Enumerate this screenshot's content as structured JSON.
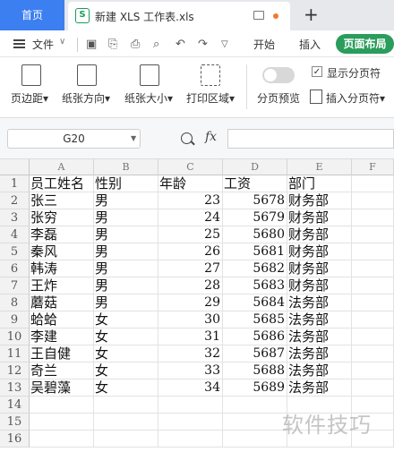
{
  "tabs": {
    "home": "首页",
    "file": "新建 XLS 工作表.xls",
    "file_icon": "S"
  },
  "menu": {
    "file": "文件",
    "start": "开始",
    "insert": "插入",
    "page_layout": "页面布局",
    "colors": {
      "active_tab_bg": "#2a9d5c",
      "home_tab_bg": "#3c7ff0"
    }
  },
  "ribbon": {
    "margins": "页边距",
    "orientation": "纸张方向",
    "paper_size": "纸张大小",
    "print_area": "打印区域",
    "page_break_preview": "分页预览",
    "show_page_breaks": "显示分页符",
    "show_page_breaks_checked": true,
    "insert_page_break": "插入分页符"
  },
  "formula_bar": {
    "name_box": "G20",
    "fx": "fx",
    "value": ""
  },
  "sheet": {
    "columns": [
      "A",
      "B",
      "C",
      "D",
      "E",
      "F"
    ],
    "row_numbers": [
      "1",
      "2",
      "3",
      "4",
      "5",
      "6",
      "7",
      "8",
      "9",
      "10",
      "11",
      "12",
      "13",
      "14",
      "15",
      "16"
    ],
    "header": [
      "员工姓名",
      "性别",
      "年龄",
      "工资",
      "部门"
    ],
    "rows": [
      [
        "张三",
        "男",
        "23",
        "5678",
        "财务部"
      ],
      [
        "张穷",
        "男",
        "24",
        "5679",
        "财务部"
      ],
      [
        "李磊",
        "男",
        "25",
        "5680",
        "财务部"
      ],
      [
        "秦风",
        "男",
        "26",
        "5681",
        "财务部"
      ],
      [
        "韩涛",
        "男",
        "27",
        "5682",
        "财务部"
      ],
      [
        "王炸",
        "男",
        "28",
        "5683",
        "财务部"
      ],
      [
        "蘑菇",
        "男",
        "29",
        "5684",
        "法务部"
      ],
      [
        "蛤蛤",
        "女",
        "30",
        "5685",
        "法务部"
      ],
      [
        "李建",
        "女",
        "31",
        "5686",
        "法务部"
      ],
      [
        "王自健",
        "女",
        "32",
        "5687",
        "法务部"
      ],
      [
        "奇兰",
        "女",
        "33",
        "5688",
        "法务部"
      ],
      [
        "吴碧藻",
        "女",
        "34",
        "5689",
        "法务部"
      ]
    ]
  },
  "watermark": "软件技巧"
}
